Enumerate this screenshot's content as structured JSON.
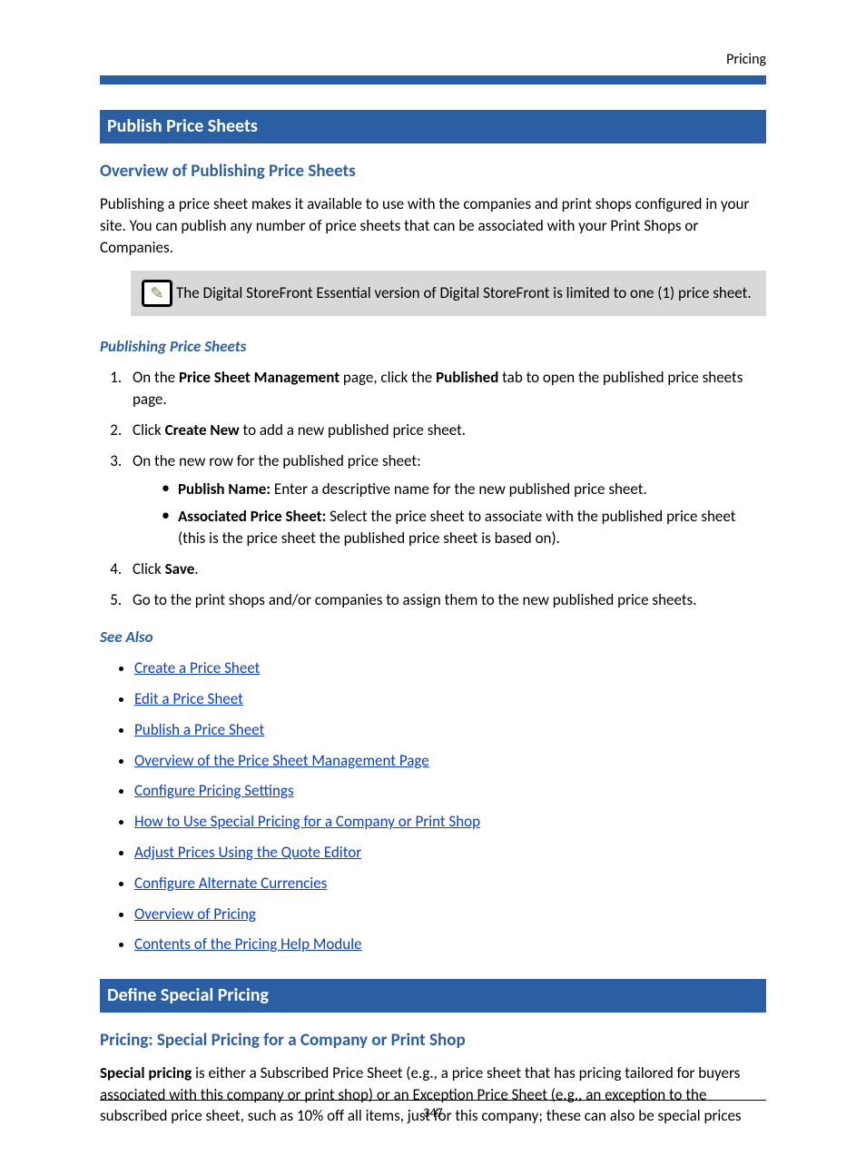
{
  "header": {
    "label": "Pricing"
  },
  "section1": {
    "barTitle": "Publish Price Sheets",
    "h2": "Overview of Publishing Price Sheets",
    "introPara": "Publishing a price sheet makes it available to use with the companies and print shops configured in your site. You can publish any number of price sheets that can be associated with your Print Shops or Companies.",
    "noteText": "The Digital StoreFront Essential version of Digital StoreFront is limited to one (1) price sheet.",
    "h3": "Publishing Price Sheets",
    "step1_a": "On the ",
    "step1_b": "Price Sheet Management",
    "step1_c": " page, click the ",
    "step1_d": "Published",
    "step1_e": " tab to open the published price sheets page.",
    "step2_a": "Click ",
    "step2_b": "Create New",
    "step2_c": " to add a new published price sheet.",
    "step3": "On the new row for the published price sheet:",
    "step3_b1_a": "Publish Name:",
    "step3_b1_b": " Enter a descriptive name for the new published price sheet.",
    "step3_b2_a": "Associated Price Sheet:",
    "step3_b2_b": " Select the price sheet to associate with the published price sheet (this is the price sheet the published price sheet is based on).",
    "step4_a": "Click ",
    "step4_b": "Save",
    "step4_c": ".",
    "step5": "Go to the print shops and/or companies to assign them to the new published price sheets.",
    "seeAlsoHead": "See Also",
    "links": [
      "Create a Price Sheet",
      "Edit a Price Sheet",
      "Publish a Price Sheet",
      "Overview of the Price Sheet Management Page",
      "Configure Pricing Settings",
      "How to Use Special Pricing for a Company or Print Shop",
      "Adjust Prices Using the Quote Editor",
      "Configure Alternate Currencies",
      "Overview of Pricing",
      "Contents of the Pricing Help Module"
    ]
  },
  "section2": {
    "barTitle": "Define Special Pricing",
    "h2": "Pricing: Special Pricing for a Company or Print Shop",
    "para_a": "Special pricing",
    "para_b": " is either a Subscribed Price Sheet (e.g., a price sheet that has pricing tailored for buyers associated with this company or print shop) or an Exception Price Sheet (e.g., an exception to the subscribed price sheet, such as 10% off all items, just for this company; these can also be special prices"
  },
  "footer": {
    "pageNum": "347"
  }
}
